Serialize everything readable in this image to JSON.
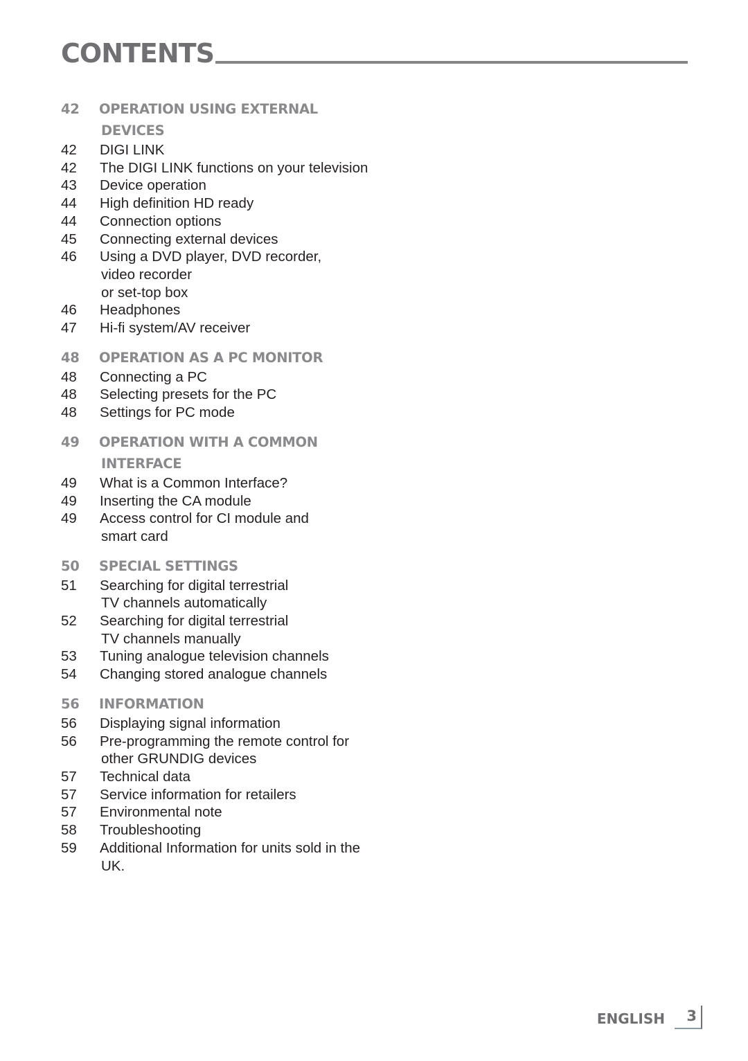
{
  "header": {
    "title": "CONTENTS"
  },
  "toc": [
    {
      "type": "section",
      "page": "42",
      "lines": [
        "OPERATION USING EXTERNAL",
        "DEVICES"
      ]
    },
    {
      "type": "entry",
      "page": "42",
      "lines": [
        "DIGI LINK"
      ]
    },
    {
      "type": "entry",
      "page": "42",
      "lines": [
        "The DIGI LINK functions on your television"
      ]
    },
    {
      "type": "entry",
      "page": "43",
      "lines": [
        "Device operation"
      ]
    },
    {
      "type": "entry",
      "page": "44",
      "lines": [
        "High definition  HD ready"
      ]
    },
    {
      "type": "entry",
      "page": "44",
      "lines": [
        "Connection options"
      ]
    },
    {
      "type": "entry",
      "page": "45",
      "lines": [
        "Connecting external devices"
      ]
    },
    {
      "type": "entry",
      "page": "46",
      "lines": [
        "Using a DVD player, DVD recorder,",
        "video recorder",
        "or set-top box"
      ]
    },
    {
      "type": "entry",
      "page": "46",
      "lines": [
        "Headphones"
      ]
    },
    {
      "type": "entry",
      "page": "47",
      "lines": [
        "Hi-fi system/AV receiver"
      ]
    },
    {
      "type": "gap"
    },
    {
      "type": "section",
      "page": "48",
      "lines": [
        "OPERATION AS A PC MONITOR"
      ]
    },
    {
      "type": "entry",
      "page": "48",
      "lines": [
        "Connecting a PC"
      ]
    },
    {
      "type": "entry",
      "page": "48",
      "lines": [
        "Selecting presets for the PC"
      ]
    },
    {
      "type": "entry",
      "page": "48",
      "lines": [
        "Settings for PC mode"
      ]
    },
    {
      "type": "gap"
    },
    {
      "type": "section",
      "page": "49",
      "lines": [
        "OPERATION WITH A COMMON",
        "INTERFACE"
      ]
    },
    {
      "type": "entry",
      "page": "49",
      "lines": [
        "What is a Common Interface?"
      ]
    },
    {
      "type": "entry",
      "page": "49",
      "lines": [
        "Inserting the CA module"
      ]
    },
    {
      "type": "entry",
      "page": "49",
      "lines": [
        "Access control for CI module and",
        "smart card"
      ]
    },
    {
      "type": "gap"
    },
    {
      "type": "section",
      "page": "50",
      "lines": [
        "SPECIAL SETTINGS"
      ]
    },
    {
      "type": "entry",
      "page": "51",
      "lines": [
        "Searching for digital terrestrial",
        "TV channels automatically"
      ]
    },
    {
      "type": "entry",
      "page": "52",
      "lines": [
        "Searching for digital terrestrial",
        "TV channels manually"
      ]
    },
    {
      "type": "entry",
      "page": "53",
      "lines": [
        "Tuning analogue television channels"
      ]
    },
    {
      "type": "entry",
      "page": "54",
      "lines": [
        "Changing stored analogue channels"
      ]
    },
    {
      "type": "gap"
    },
    {
      "type": "section",
      "page": "56",
      "lines": [
        "INFORMATION"
      ]
    },
    {
      "type": "entry",
      "page": "56",
      "lines": [
        "Displaying signal information"
      ]
    },
    {
      "type": "entry",
      "page": "56",
      "lines": [
        "Pre-programming the remote control for",
        "other GRUNDIG devices"
      ]
    },
    {
      "type": "entry",
      "page": "57",
      "lines": [
        "Technical data"
      ]
    },
    {
      "type": "entry",
      "page": "57",
      "lines": [
        "Service information for retailers"
      ]
    },
    {
      "type": "entry",
      "page": "57",
      "lines": [
        "Environmental note"
      ]
    },
    {
      "type": "entry",
      "page": "58",
      "lines": [
        "Troubleshooting"
      ]
    },
    {
      "type": "entry",
      "page": "59",
      "lines": [
        "Additional Information for units sold in the",
        "UK."
      ]
    }
  ],
  "footer": {
    "language": "ENGLISH",
    "page_number": "3"
  }
}
